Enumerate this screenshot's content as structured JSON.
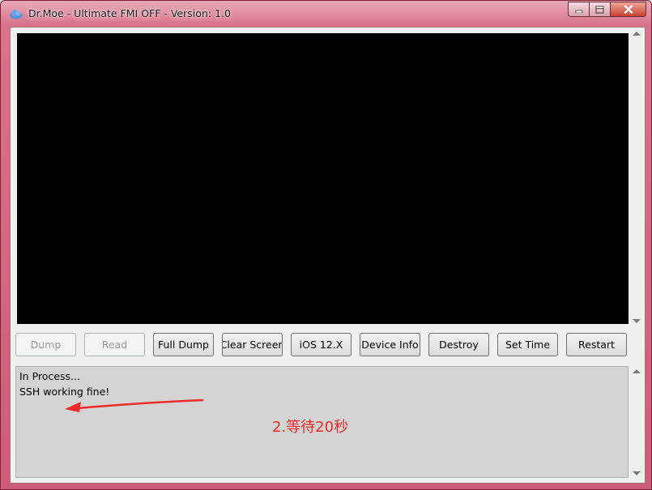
{
  "window": {
    "title": "Dr.Moe - Ultimate FMI OFF - Version: 1.0",
    "app_icon": "cloud-icon",
    "caption_buttons": [
      "minimize-icon",
      "maximize-icon",
      "close-icon"
    ]
  },
  "toolbar": {
    "buttons": [
      {
        "label": "Dump",
        "enabled": false
      },
      {
        "label": "Read",
        "enabled": false
      },
      {
        "label": "Full Dump",
        "enabled": true
      },
      {
        "label": "Clear Screen",
        "enabled": true
      },
      {
        "label": "iOS 12.X",
        "enabled": true
      },
      {
        "label": "Device Info",
        "enabled": true
      },
      {
        "label": "Destroy",
        "enabled": true
      },
      {
        "label": "Set Time",
        "enabled": true
      },
      {
        "label": "Restart",
        "enabled": true
      }
    ]
  },
  "log": {
    "lines": [
      "In Process...",
      "SSH working fine!"
    ]
  },
  "annotation": {
    "text": "2.等待20秒",
    "color": "#ee2a2a"
  },
  "colors": {
    "frame": "#d9728a",
    "screen": "#000000",
    "log_background": "#d4d4d4"
  }
}
